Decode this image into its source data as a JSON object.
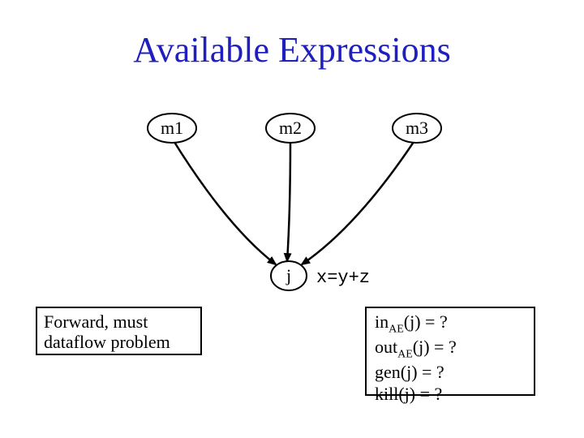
{
  "title": "Available Expressions",
  "nodes": {
    "m1": "m1",
    "m2": "m2",
    "m3": "m3",
    "j": "j"
  },
  "expr": "x=y+z",
  "forward_box": {
    "line1": "Forward, must",
    "line2": "dataflow problem"
  },
  "eqns": {
    "in_prefix": "in",
    "in_sub": "AE",
    "in_suffix": "(j) = ?",
    "out_prefix": "out",
    "out_sub": "AE",
    "out_suffix": "(j) = ?",
    "gen": "gen(j) = ?",
    "kill": "kill(j) = ?"
  }
}
